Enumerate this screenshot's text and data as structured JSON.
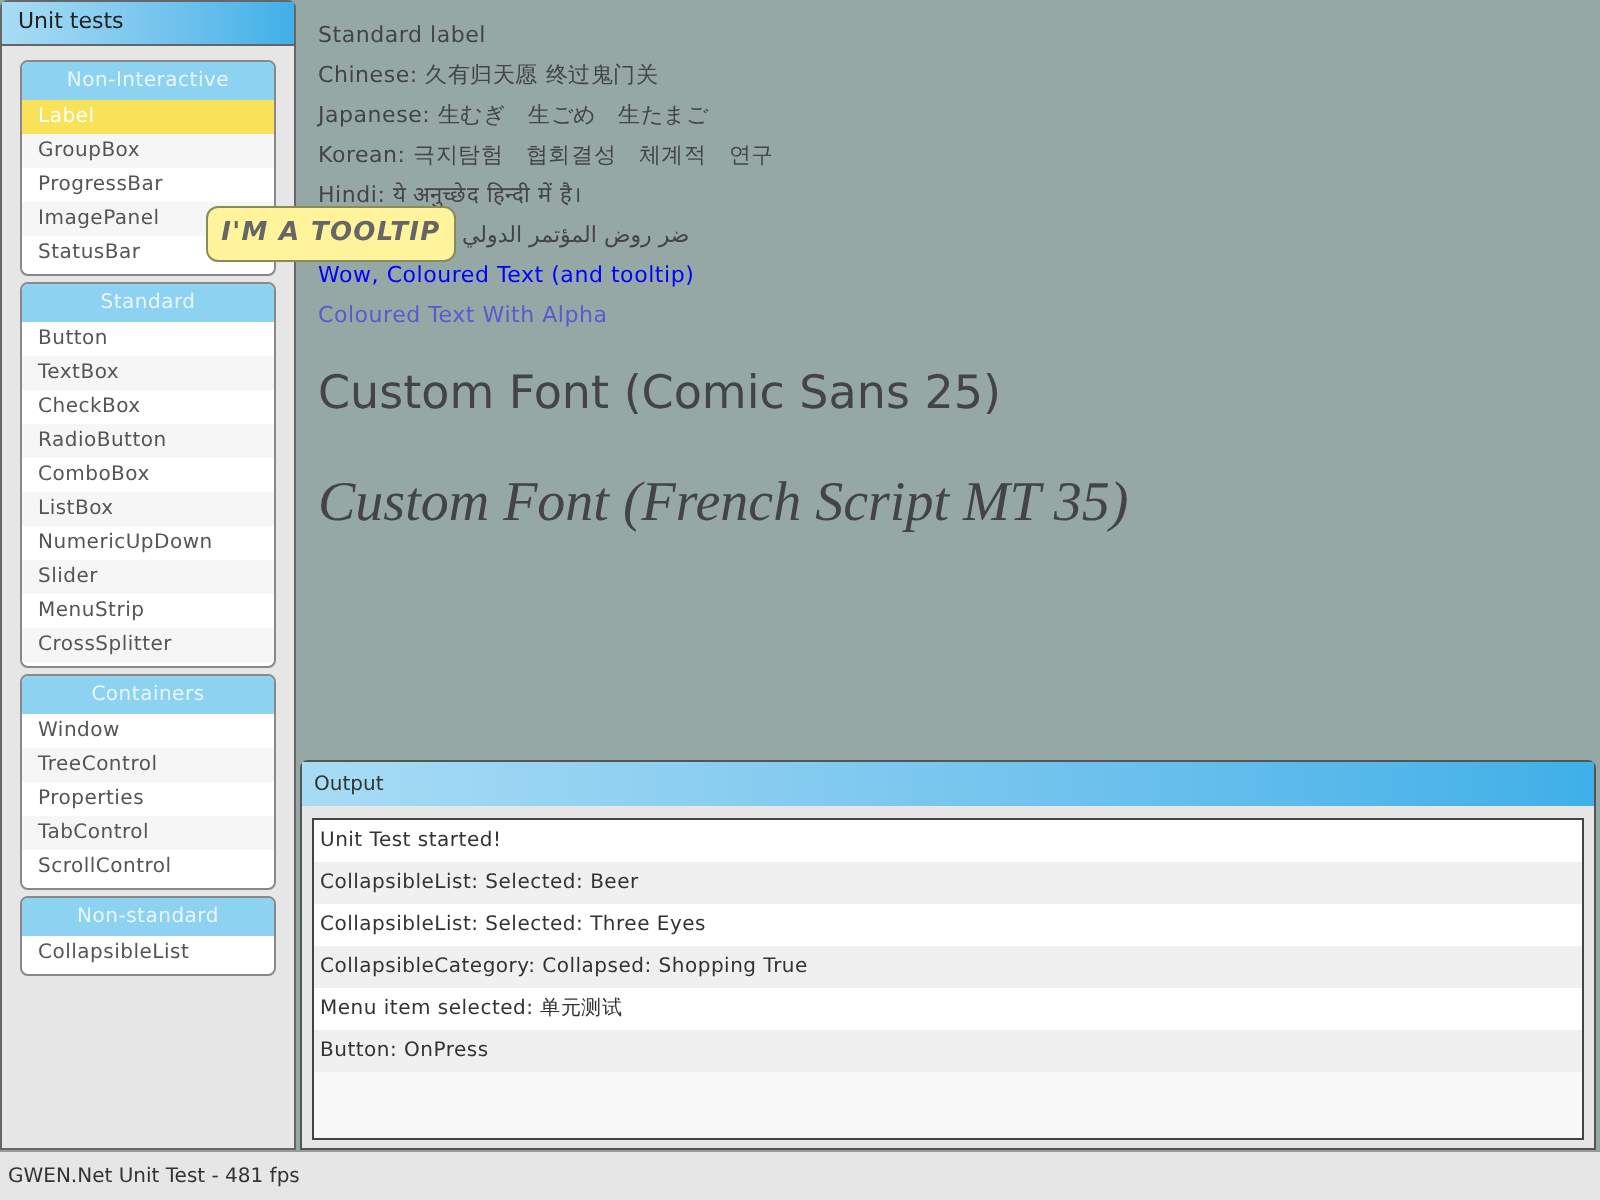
{
  "sidebar": {
    "title": "Unit tests",
    "sections": [
      {
        "title": "Non-Interactive",
        "items": [
          {
            "label": "Label",
            "selected": true
          },
          {
            "label": "GroupBox",
            "selected": false
          },
          {
            "label": "ProgressBar",
            "selected": false
          },
          {
            "label": "ImagePanel",
            "selected": false
          },
          {
            "label": "StatusBar",
            "selected": false
          }
        ]
      },
      {
        "title": "Standard",
        "items": [
          {
            "label": "Button",
            "selected": false
          },
          {
            "label": "TextBox",
            "selected": false
          },
          {
            "label": "CheckBox",
            "selected": false
          },
          {
            "label": "RadioButton",
            "selected": false
          },
          {
            "label": "ComboBox",
            "selected": false
          },
          {
            "label": "ListBox",
            "selected": false
          },
          {
            "label": "NumericUpDown",
            "selected": false
          },
          {
            "label": "Slider",
            "selected": false
          },
          {
            "label": "MenuStrip",
            "selected": false
          },
          {
            "label": "CrossSplitter",
            "selected": false
          }
        ]
      },
      {
        "title": "Containers",
        "items": [
          {
            "label": "Window",
            "selected": false
          },
          {
            "label": "TreeControl",
            "selected": false
          },
          {
            "label": "Properties",
            "selected": false
          },
          {
            "label": "TabControl",
            "selected": false
          },
          {
            "label": "ScrollControl",
            "selected": false
          }
        ]
      },
      {
        "title": "Non-standard",
        "items": [
          {
            "label": "CollapsibleList",
            "selected": false
          }
        ]
      }
    ]
  },
  "labels": [
    {
      "text": "Standard label",
      "kind": "plain"
    },
    {
      "text": "Chinese: 久有归天愿 终过鬼门关",
      "kind": "plain"
    },
    {
      "text": "Japanese: 生むぎ　生ごめ　生たまご",
      "kind": "plain"
    },
    {
      "text": "Korean: 극지탐험　협회결성　체계적　연구",
      "kind": "plain"
    },
    {
      "text": "Hindi: ये अनुच्छेद हिन्दी में है।",
      "kind": "plain"
    },
    {
      "text": "ضر روض المؤتمر الدولي",
      "kind": "covered"
    },
    {
      "text": "Wow, Coloured Text (and tooltip)",
      "kind": "color",
      "color": "#0000ff"
    },
    {
      "text": "Coloured Text With Alpha",
      "kind": "color",
      "color": "#5a5ad0"
    },
    {
      "text": "Custom Font (Comic Sans 25)",
      "kind": "large"
    },
    {
      "text": "Custom Font (French Script MT 35)",
      "kind": "script"
    }
  ],
  "tooltip": "I'M A TOOLTIP",
  "output": {
    "title": "Output",
    "lines": [
      "Unit Test started!",
      "CollapsibleList: Selected: Beer",
      "CollapsibleList: Selected: Three Eyes",
      "CollapsibleCategory: Collapsed: Shopping True",
      "Menu item selected: 单元测试",
      "Button: OnPress"
    ]
  },
  "status_bar": "GWEN.Net Unit Test - 481 fps"
}
